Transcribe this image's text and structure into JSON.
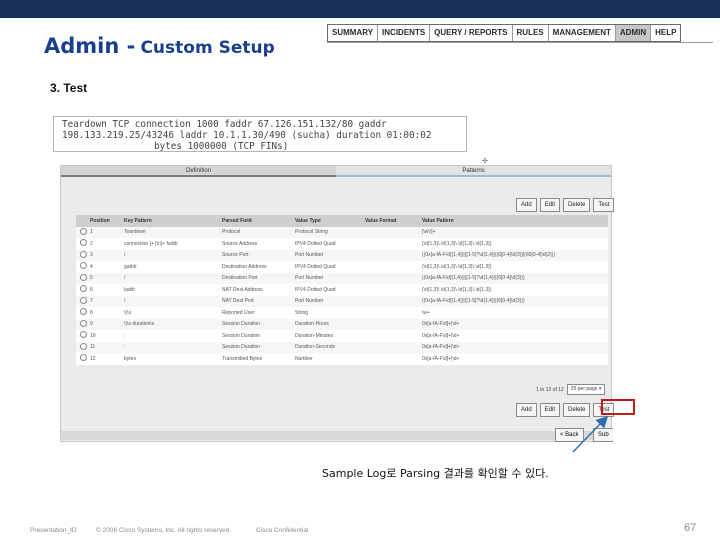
{
  "header": {
    "title_main": "Admin -",
    "title_sub": "Custom Setup"
  },
  "nav": {
    "items": [
      {
        "label": "SUMMARY",
        "active": false
      },
      {
        "label": "INCIDENTS",
        "active": false
      },
      {
        "label": "QUERY / REPORTS",
        "active": false
      },
      {
        "label": "RULES",
        "active": false
      },
      {
        "label": "MANAGEMENT",
        "active": false
      },
      {
        "label": "ADMIN",
        "active": true
      },
      {
        "label": "HELP",
        "active": false
      }
    ]
  },
  "section": {
    "title": "3. Test"
  },
  "log": {
    "lines": [
      "Teardown TCP connection 1000 faddr 67.126.151.132/80 gaddr",
      "198.133.219.25/43246 laddr 10.1.1.30/490 (sucha) duration 01:00:02",
      "bytes 1000000 (TCP FINs)"
    ]
  },
  "panel": {
    "tab_left": "Definition",
    "tab_right": "Patterns",
    "buttons": [
      "Add",
      "Edit",
      "Delete",
      "Test"
    ],
    "columns": [
      "Position",
      "Key Pattern",
      "Parsed Field",
      "Value Type",
      "Value Format",
      "Value Pattern"
    ],
    "rows": [
      {
        "pos": "1",
        "key": "Teardown",
        "field": "Protocol",
        "type": "Protocol String",
        "format": "",
        "pattern": "[\\w\\/]+"
      },
      {
        "pos": "2",
        "key": "connection [+ [\\n]+ faddr",
        "field": "Source Address",
        "type": "IPV4 Dotted Quad",
        "format": "",
        "pattern": "(\\d{1,3}\\.\\d{1,3}\\.\\d{1,3}\\.\\d{1,3})"
      },
      {
        "pos": "3",
        "key": "/",
        "field": "Source Port",
        "type": "Port Number",
        "format": "",
        "pattern": "((0x[a-fA-F\\d]{1,4})|([1-5]?\\d{1,4})|(6[0-4]\\d{3})|(65[0-4]\\d{2}))"
      },
      {
        "pos": "4",
        "key": "gaddr",
        "field": "Destination Address",
        "type": "IPV4 Dotted Quad",
        "format": "",
        "pattern": "(\\d{1,3}\\.\\d{1,3}\\.\\d{1,3}\\.\\d{1,3})"
      },
      {
        "pos": "5",
        "key": "/",
        "field": "Destination Port",
        "type": "Port Number",
        "format": "",
        "pattern": "((0x[a-fA-F\\d]{1,4})|([1-5]?\\d{1,4})|(6[0-4]\\d{3}))"
      },
      {
        "pos": "6",
        "key": "laddr",
        "field": "NAT Dest Address",
        "type": "IPV4 Dotted Quad",
        "format": "",
        "pattern": "(\\d{1,3}\\.\\d{1,3}\\.\\d{1,3}\\.\\d{1,3})"
      },
      {
        "pos": "7",
        "key": "/",
        "field": "NAT Dest Port",
        "type": "Port Number",
        "format": "",
        "pattern": "((0x[a-fA-F\\d]{1,4})|([1-5]?\\d{1,4})|(6[0-4]\\d{3}))"
      },
      {
        "pos": "8",
        "key": "\\(\\s",
        "field": "Reported User",
        "type": "String",
        "format": "",
        "pattern": "\\w+"
      },
      {
        "pos": "9",
        "key": "\\)\\s duration\\s",
        "field": "Session Duration",
        "type": "Duration-Hours",
        "format": "",
        "pattern": "0x[a-fA-F\\d]+|\\d+"
      },
      {
        "pos": "10",
        "key": ":",
        "field": "Session Duration",
        "type": "Duration-Minutes",
        "format": "",
        "pattern": "0x[a-fA-F\\d]+|\\d+"
      },
      {
        "pos": "11",
        "key": ":",
        "field": "Session Duration",
        "type": "Duration-Seconds",
        "format": "",
        "pattern": "0x[a-fA-F\\d]+|\\d+"
      },
      {
        "pos": "12",
        "key": "bytes",
        "field": "Transmitted Bytes",
        "type": "Number",
        "format": "",
        "pattern": "0x[a-fA-F\\d]+|\\d+"
      }
    ],
    "pager_text": "1 to 12 of 12",
    "per_page": "25 per page"
  },
  "nav_buttons": {
    "back": "< Back",
    "submit": "Sub"
  },
  "caption": "Sample Log로 Parsing 결과를 확인할 수 있다.",
  "footer": {
    "presentation_id": "Presentation_ID",
    "copyright": "© 2006 Cisco Systems, Inc. All rights reserved.",
    "confidential": "Cisco Confidential",
    "page": "67"
  },
  "colors": {
    "topbar": "#16305a",
    "title": "#1a3f8c",
    "highlight": "#c21a1a",
    "arrow": "#2f6fb5"
  }
}
